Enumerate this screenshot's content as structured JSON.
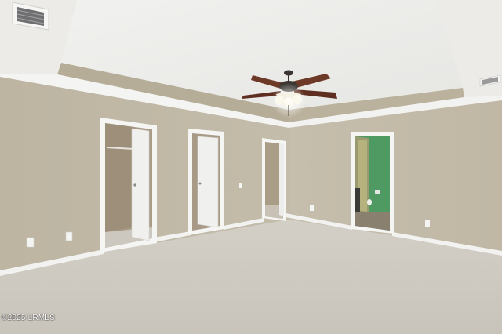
{
  "photo": {
    "watermark": "©2025 LRMLS"
  },
  "colors": {
    "wall": "#c2b9a7",
    "wall_shade": "#b7ae9b",
    "ceiling": "#efefed",
    "tray_band": "#b6ad98",
    "carpet": "#cfcbc3",
    "trim": "#f3f3f1",
    "door": "#f0f0ee",
    "closet_interior": "#a89a85",
    "bathroom_wall": "#4f9a62",
    "bathroom_floor": "#8a8070",
    "fan_blade": "#6e3a28"
  }
}
